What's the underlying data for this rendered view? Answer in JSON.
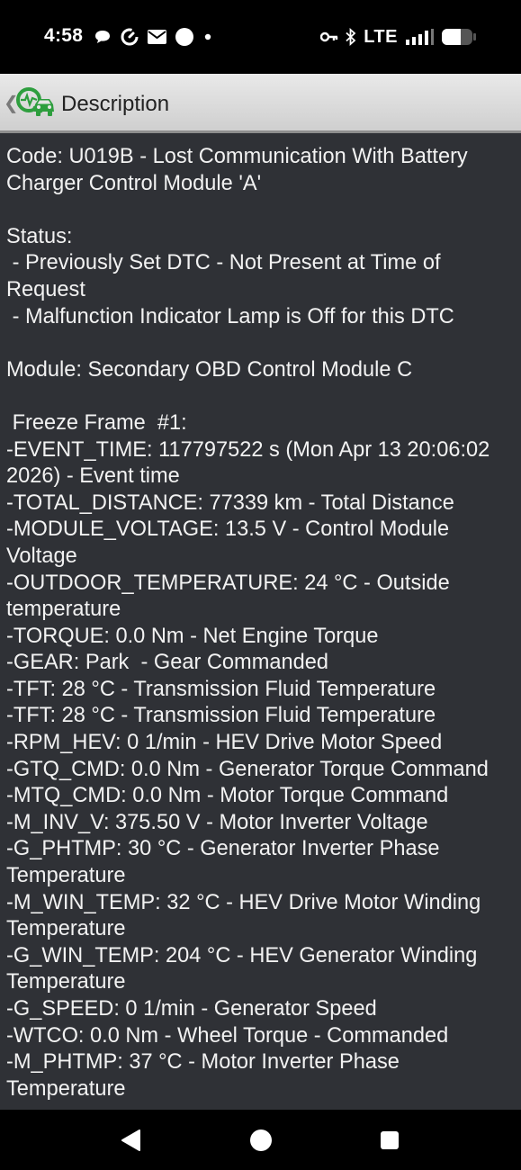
{
  "status_bar": {
    "time": "4:58",
    "network": "LTE",
    "left_icons": [
      "chat-icon",
      "sync-icon",
      "mail-icon",
      "circle-icon",
      "dot-icon"
    ],
    "right_icons": [
      "key-icon",
      "bluetooth-icon",
      "signal-icon",
      "battery-icon"
    ]
  },
  "header": {
    "title": "Description",
    "logo_icon": "car-diagnostic-icon",
    "accent_color": "#2e9e3e"
  },
  "description": {
    "text": "Code: U019B - Lost Communication With Battery\nCharger Control Module 'A'\n\nStatus:\n - Previously Set DTC - Not Present at Time of\nRequest\n - Malfunction Indicator Lamp is Off for this DTC\n\nModule: Secondary OBD Control Module C\n\n Freeze Frame  #1:\n-EVENT_TIME: 117797522 s (Mon Apr 13 20:06:02\n2026) - Event time\n-TOTAL_DISTANCE: 77339 km - Total Distance\n-MODULE_VOLTAGE: 13.5 V - Control Module\nVoltage\n-OUTDOOR_TEMPERATURE: 24 °C - Outside\ntemperature\n-TORQUE: 0.0 Nm - Net Engine Torque\n-GEAR: Park  - Gear Commanded\n-TFT: 28 °C - Transmission Fluid Temperature\n-TFT: 28 °C - Transmission Fluid Temperature\n-RPM_HEV: 0 1/min - HEV Drive Motor Speed\n-GTQ_CMD: 0.0 Nm - Generator Torque Command\n-MTQ_CMD: 0.0 Nm - Motor Torque Command\n-M_INV_V: 375.50 V - Motor Inverter Voltage\n-G_PHTMP: 30 °C - Generator Inverter Phase\nTemperature\n-M_WIN_TEMP: 32 °C - HEV Drive Motor Winding\nTemperature\n-G_WIN_TEMP: 204 °C - HEV Generator Winding\nTemperature\n-G_SPEED: 0 1/min - Generator Speed\n-WTCO: 0.0 Nm - Wheel Torque - Commanded\n-M_PHTMP: 37 °C - Motor Inverter Phase\nTemperature"
  },
  "nav_bar": {
    "buttons": [
      "back-icon",
      "home-icon",
      "recents-icon"
    ]
  }
}
